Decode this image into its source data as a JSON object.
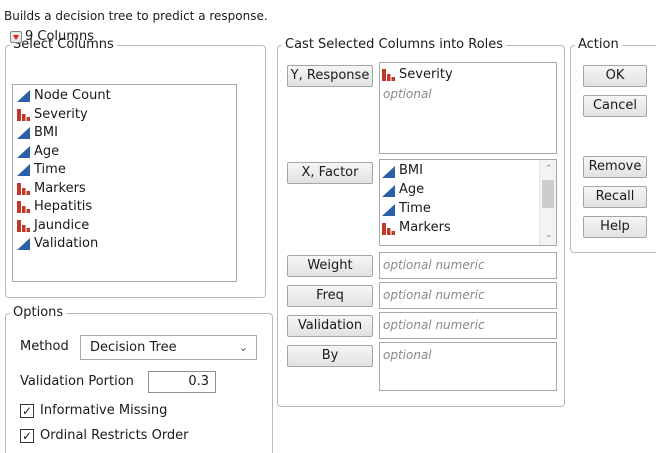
{
  "description": "Builds a decision tree to predict a response.",
  "select_columns": {
    "title": "Select Columns",
    "count_label": "9 Columns",
    "columns": [
      {
        "label": "Node Count",
        "type": "continuous"
      },
      {
        "label": "Severity",
        "type": "nominal"
      },
      {
        "label": "BMI",
        "type": "continuous"
      },
      {
        "label": "Age",
        "type": "continuous"
      },
      {
        "label": "Time",
        "type": "continuous"
      },
      {
        "label": "Markers",
        "type": "nominal"
      },
      {
        "label": "Hepatitis",
        "type": "nominal"
      },
      {
        "label": "Jaundice",
        "type": "nominal"
      },
      {
        "label": "Validation",
        "type": "continuous"
      }
    ]
  },
  "cast": {
    "title": "Cast Selected Columns into Roles",
    "roles": {
      "y": {
        "button": "Y, Response",
        "items": [
          "Severity"
        ],
        "placeholder": "optional"
      },
      "x": {
        "button": "X, Factor",
        "items": [
          "BMI",
          "Age",
          "Time",
          "Markers"
        ]
      },
      "weight": {
        "button": "Weight",
        "placeholder": "optional numeric"
      },
      "freq": {
        "button": "Freq",
        "placeholder": "optional numeric"
      },
      "validation": {
        "button": "Validation",
        "placeholder": "optional numeric"
      },
      "by": {
        "button": "By",
        "placeholder": "optional"
      }
    }
  },
  "action": {
    "title": "Action",
    "ok": "OK",
    "cancel": "Cancel",
    "remove": "Remove",
    "recall": "Recall",
    "help": "Help"
  },
  "options": {
    "title": "Options",
    "method_label": "Method",
    "method_value": "Decision Tree",
    "validation_portion_label": "Validation Portion",
    "validation_portion_value": "0.3",
    "informative_missing_label": "Informative Missing",
    "informative_missing_checked": true,
    "ordinal_restricts_label": "Ordinal Restricts Order",
    "ordinal_restricts_checked": true
  },
  "colors": {
    "continuous_icon": "#2b5fa8",
    "nominal_icon": "#c0392b",
    "column_menu_arrow": "#d21f1f"
  }
}
